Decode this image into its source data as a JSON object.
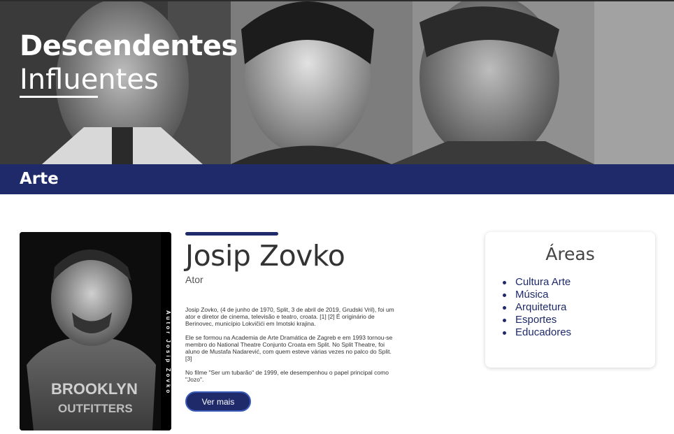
{
  "hero": {
    "title_line1": "Descendentes",
    "title_line2": "Influentes"
  },
  "category": {
    "label": "Arte"
  },
  "profile": {
    "photo_credit": "Autor Josip Zovko",
    "name": "Josip Zovko",
    "role": "Ator",
    "bio": [
      "Josip Zovko, (4 de junho de 1970, Split, 3 de abril de 2019, Grudski Vril), foi um ator e diretor de cinema, televisão e teatro, croata. [1] [2] É originário de Berinovec, município Lokvičići em Imotski krajina.",
      "Ele se formou na Academia de Arte Dramática de Zagreb e em 1993 tornou-se membro do National Theatre Conjunto Croata em Split. No Split Theatre, foi aluno de Mustafa Nadarević, com quem esteve várias vezes no palco do Split.[3]",
      "No filme \"Ser um tubarão\" de 1999, ele desempenhou o papel principal como \"Jozo\"."
    ],
    "more_button": "Ver mais"
  },
  "areas": {
    "title": "Áreas",
    "items": [
      "Cultura Arte",
      "Música",
      "Arquitetura",
      "Esportes",
      "Educadores"
    ]
  },
  "colors": {
    "primary": "#1f2a6b",
    "button_border": "#3a5ab8"
  },
  "icons": {
    "list_bullet": "bullet-dot-icon"
  }
}
